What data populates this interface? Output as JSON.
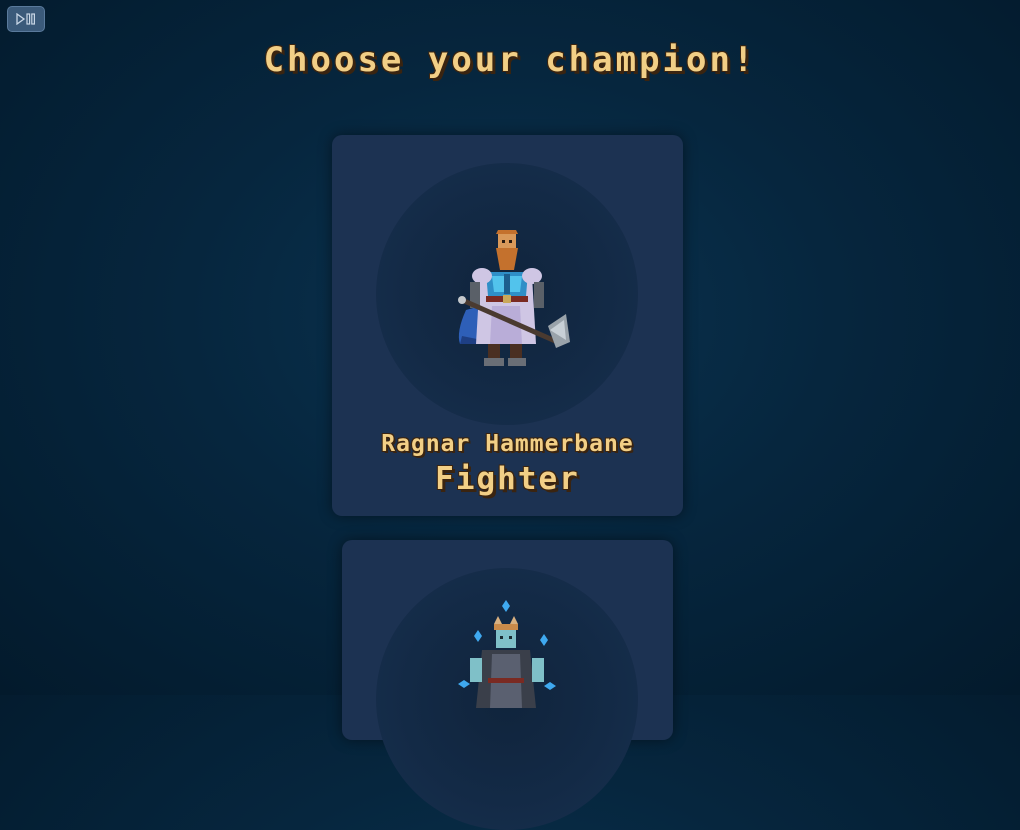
{
  "controls": {
    "play_pause_icon": "play-pause-icon"
  },
  "screen": {
    "title": "Choose your champion!"
  },
  "champions": [
    {
      "name": "Ragnar Hammerbane",
      "class": "Fighter",
      "sprite": "dwarf-fighter-icon"
    },
    {
      "name": "",
      "class": "",
      "sprite": "crystal-mage-icon"
    }
  ],
  "colors": {
    "title_gold": "#f2cf86",
    "card_bg": "#1c3252",
    "page_bg": "#06263e"
  }
}
